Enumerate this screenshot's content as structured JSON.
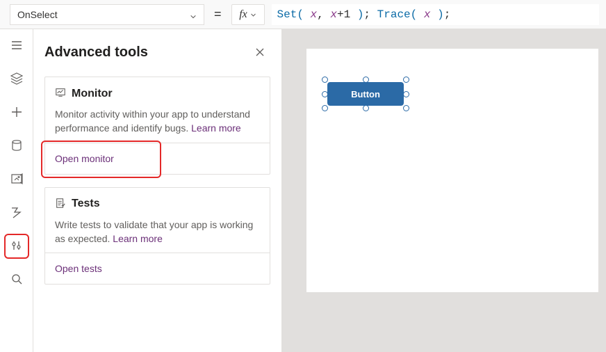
{
  "topbar": {
    "property_selected": "OnSelect",
    "equals": "=",
    "fx_label": "fx",
    "formula_tokens": [
      {
        "t": "fn",
        "v": "Set"
      },
      {
        "t": "paren",
        "v": "("
      },
      {
        "t": "sp",
        "v": " "
      },
      {
        "t": "var",
        "v": "x"
      },
      {
        "t": "punc",
        "v": ","
      },
      {
        "t": "sp",
        "v": " "
      },
      {
        "t": "var",
        "v": "x"
      },
      {
        "t": "op",
        "v": "+"
      },
      {
        "t": "num",
        "v": "1"
      },
      {
        "t": "sp",
        "v": " "
      },
      {
        "t": "paren",
        "v": ")"
      },
      {
        "t": "punc",
        "v": ";"
      },
      {
        "t": "sp",
        "v": " "
      },
      {
        "t": "fn",
        "v": "Trace"
      },
      {
        "t": "paren",
        "v": "("
      },
      {
        "t": "sp",
        "v": " "
      },
      {
        "t": "var",
        "v": "x"
      },
      {
        "t": "sp",
        "v": " "
      },
      {
        "t": "paren",
        "v": ")"
      },
      {
        "t": "punc",
        "v": ";"
      }
    ]
  },
  "rail": {
    "items": [
      {
        "name": "hamburger-icon"
      },
      {
        "name": "tree-view-icon"
      },
      {
        "name": "add-icon"
      },
      {
        "name": "data-icon"
      },
      {
        "name": "media-icon"
      },
      {
        "name": "flows-icon"
      },
      {
        "name": "advanced-tools-icon",
        "highlighted": true
      },
      {
        "name": "search-icon"
      }
    ]
  },
  "pane": {
    "title": "Advanced tools",
    "cards": [
      {
        "icon": "monitor-icon",
        "title": "Monitor",
        "desc": "Monitor activity within your app to understand performance and identify bugs.",
        "learn_more": "Learn more",
        "action": "Open monitor",
        "action_highlighted": true
      },
      {
        "icon": "tests-icon",
        "title": "Tests",
        "desc": "Write tests to validate that your app is working as expected.",
        "learn_more": "Learn more",
        "action": "Open tests",
        "action_highlighted": false
      }
    ]
  },
  "canvas": {
    "button_label": "Button"
  }
}
